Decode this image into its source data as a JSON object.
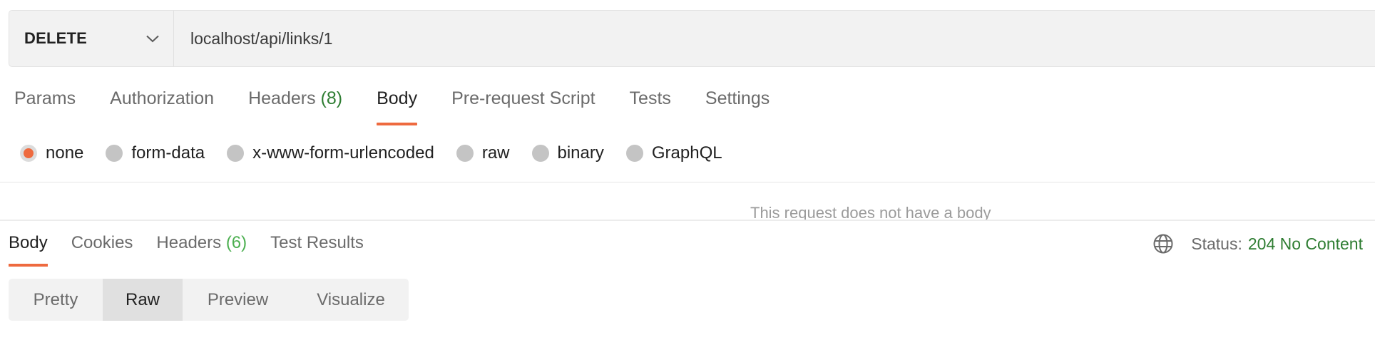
{
  "request": {
    "method": "DELETE",
    "url": "localhost/api/links/1"
  },
  "request_tabs": [
    {
      "label": "Params",
      "count": ""
    },
    {
      "label": "Authorization",
      "count": ""
    },
    {
      "label": "Headers",
      "count": "(8)"
    },
    {
      "label": "Body",
      "count": "",
      "active": true
    },
    {
      "label": "Pre-request Script",
      "count": ""
    },
    {
      "label": "Tests",
      "count": ""
    },
    {
      "label": "Settings",
      "count": ""
    }
  ],
  "body_types": [
    {
      "label": "none",
      "checked": true
    },
    {
      "label": "form-data",
      "checked": false
    },
    {
      "label": "x-www-form-urlencoded",
      "checked": false
    },
    {
      "label": "raw",
      "checked": false
    },
    {
      "label": "binary",
      "checked": false
    },
    {
      "label": "GraphQL",
      "checked": false
    }
  ],
  "empty_body_message": "This request does not have a body",
  "response_tabs": [
    {
      "label": "Body",
      "count": "",
      "active": true
    },
    {
      "label": "Cookies",
      "count": ""
    },
    {
      "label": "Headers",
      "count": "(6)"
    },
    {
      "label": "Test Results",
      "count": ""
    }
  ],
  "status": {
    "icon": "globe-icon",
    "label": "Status:",
    "value": "204 No Content"
  },
  "view_modes": [
    {
      "label": "Pretty",
      "active": false
    },
    {
      "label": "Raw",
      "active": true
    },
    {
      "label": "Preview",
      "active": false
    },
    {
      "label": "Visualize",
      "active": false
    }
  ],
  "colors": {
    "accent": "#ee6a3f",
    "success": "#2e7d32"
  }
}
